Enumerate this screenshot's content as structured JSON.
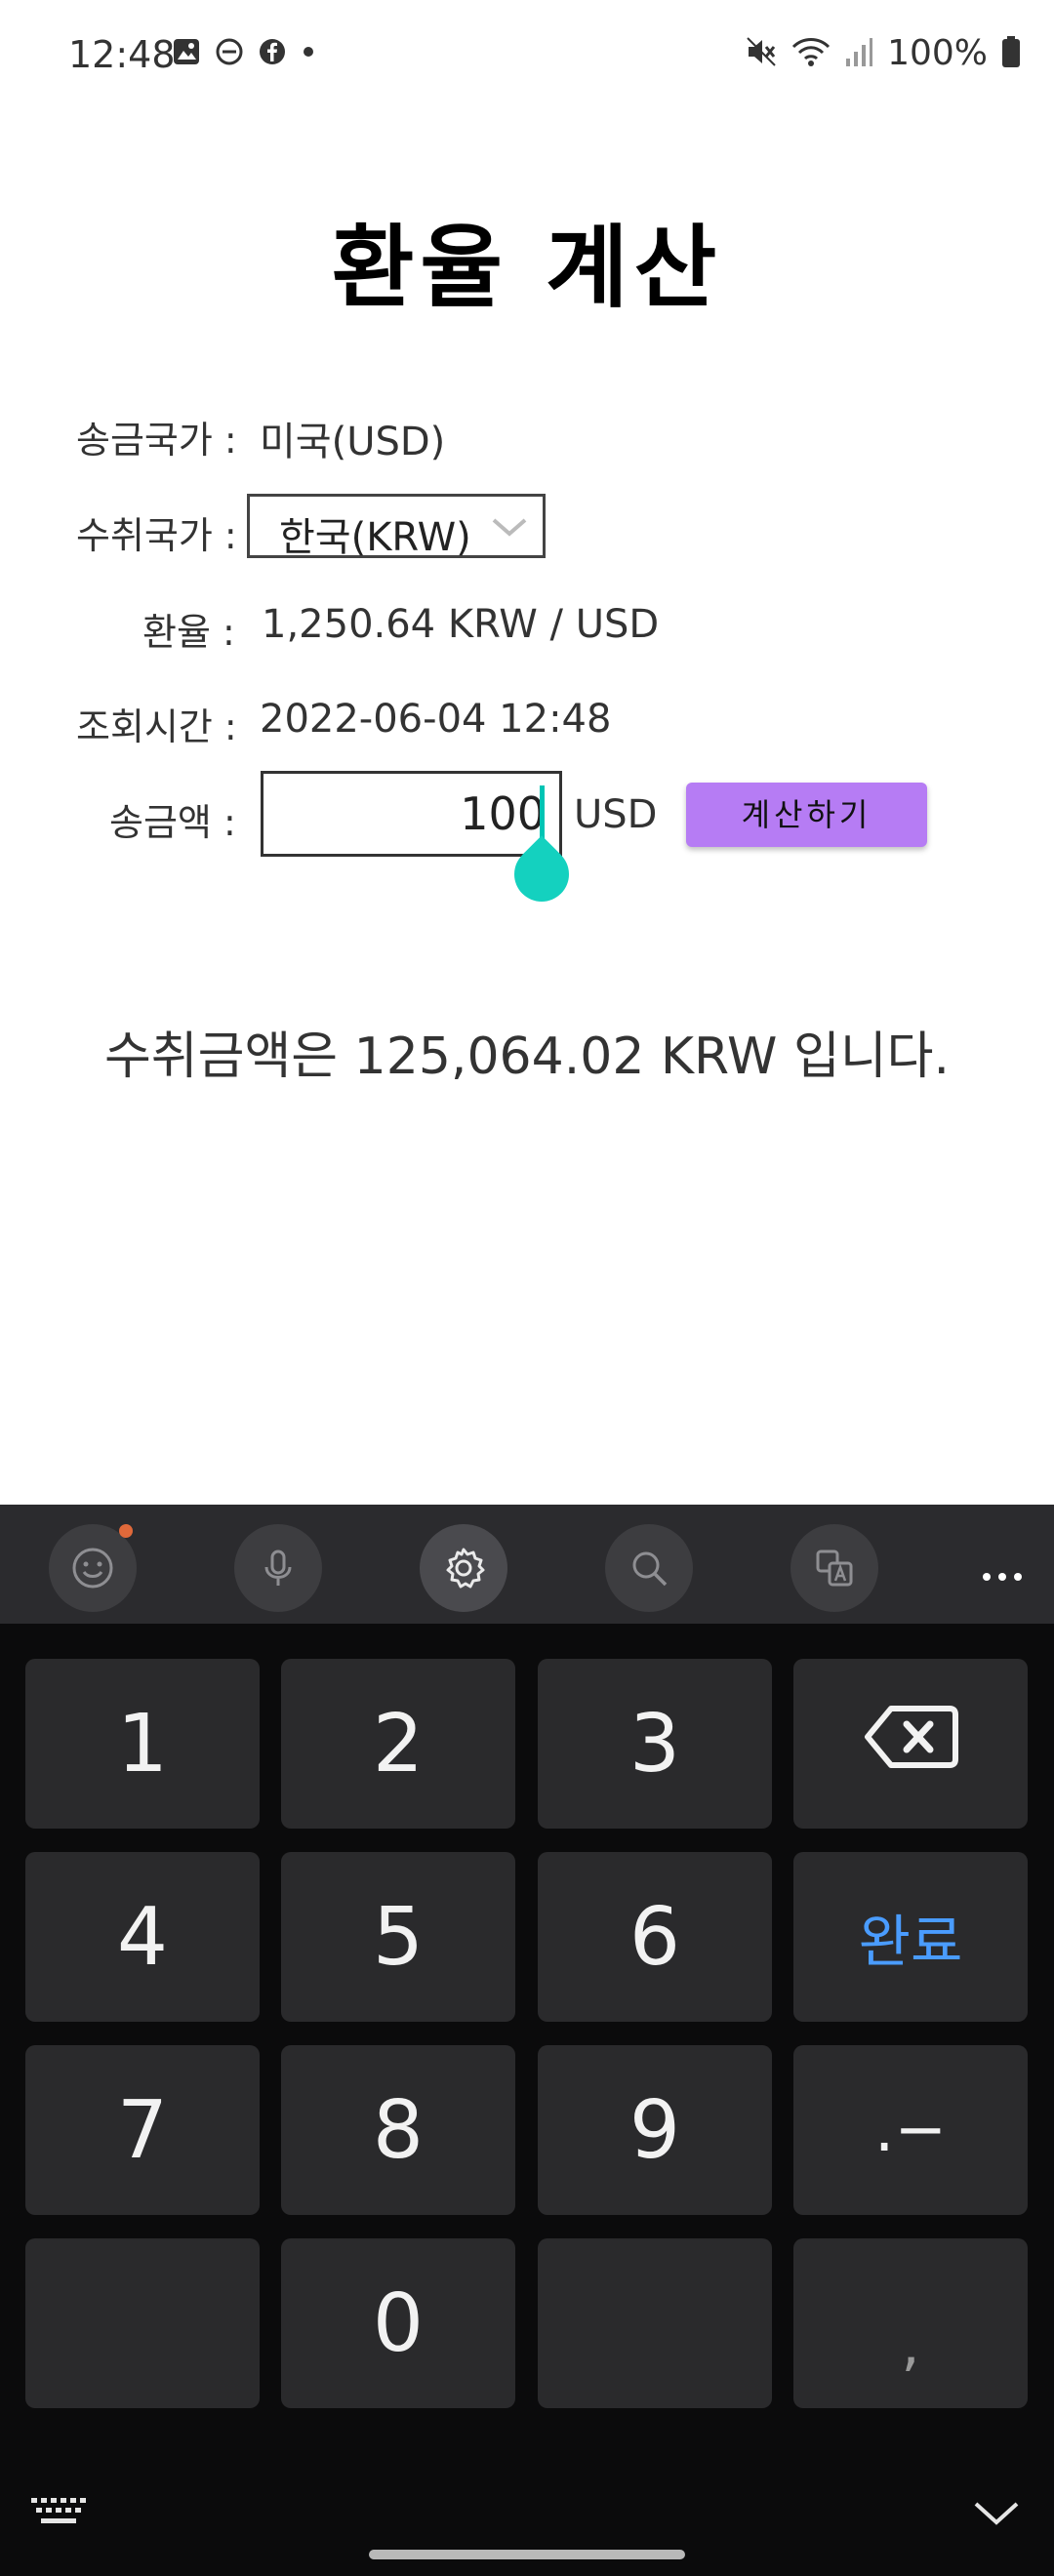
{
  "status_bar": {
    "time": "12:48",
    "battery": "100%"
  },
  "app": {
    "title": "환율 계산",
    "send_country_label": "송금국가 :",
    "send_country_value": "미국(USD)",
    "receive_country_label": "수취국가 :",
    "receive_country_selected": "한국(KRW)",
    "rate_label": "환율 :",
    "rate_value": "1,250.64 KRW / USD",
    "time_label": "조회시간 :",
    "time_value": "2022-06-04 12:48",
    "amount_label": "송금액 :",
    "amount_value": "100",
    "amount_unit": "USD",
    "calc_button": "계산하기",
    "result": "수취금액은 125,064.02 KRW 입니다."
  },
  "keyboard": {
    "toolbar_icons": [
      "emoji-icon",
      "microphone-icon",
      "settings-icon",
      "search-icon",
      "translate-icon",
      "more-icon"
    ],
    "keys": {
      "k1": "1",
      "k2": "2",
      "k3": "3",
      "k4": "4",
      "k5": "5",
      "k6": "6",
      "done": "완료",
      "k7": "7",
      "k8": "8",
      "k9": "9",
      "dot_minus": ".−",
      "k0": "0",
      "comma": ","
    },
    "done_color": "#4a9cff"
  },
  "colors": {
    "accent_button": "#b67cf4",
    "caret": "#14d1bf"
  }
}
